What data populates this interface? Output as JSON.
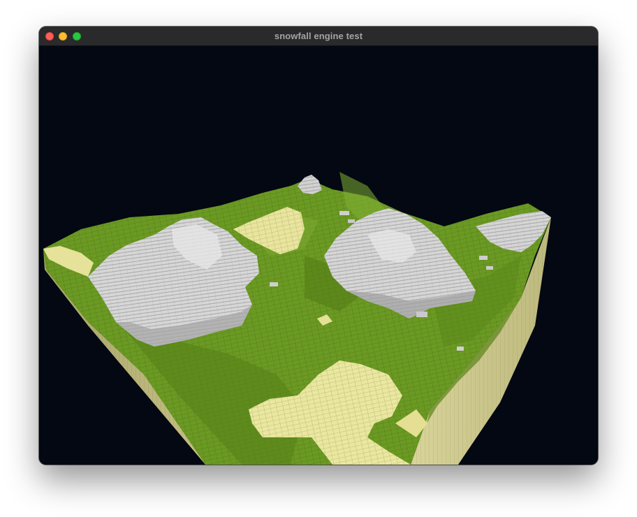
{
  "window": {
    "title": "snowfall engine test",
    "controls": {
      "close": "close-button",
      "minimize": "minimize-button",
      "maximize": "maximize-button"
    },
    "colors": {
      "titlebar": "#2a2a2c",
      "close": "#fe5f57",
      "minimize": "#febc2e",
      "maximize": "#28c840"
    }
  },
  "scene": {
    "background": "#030812",
    "content": "voxel terrain render",
    "colors": {
      "grass": "#6a9a22",
      "grass_dark": "#4d7414",
      "snow": "#d6d6d6",
      "snow_shadow": "#9c9c9c",
      "sand": "#e8e49a",
      "dirt_side": "#b8b47a"
    }
  }
}
